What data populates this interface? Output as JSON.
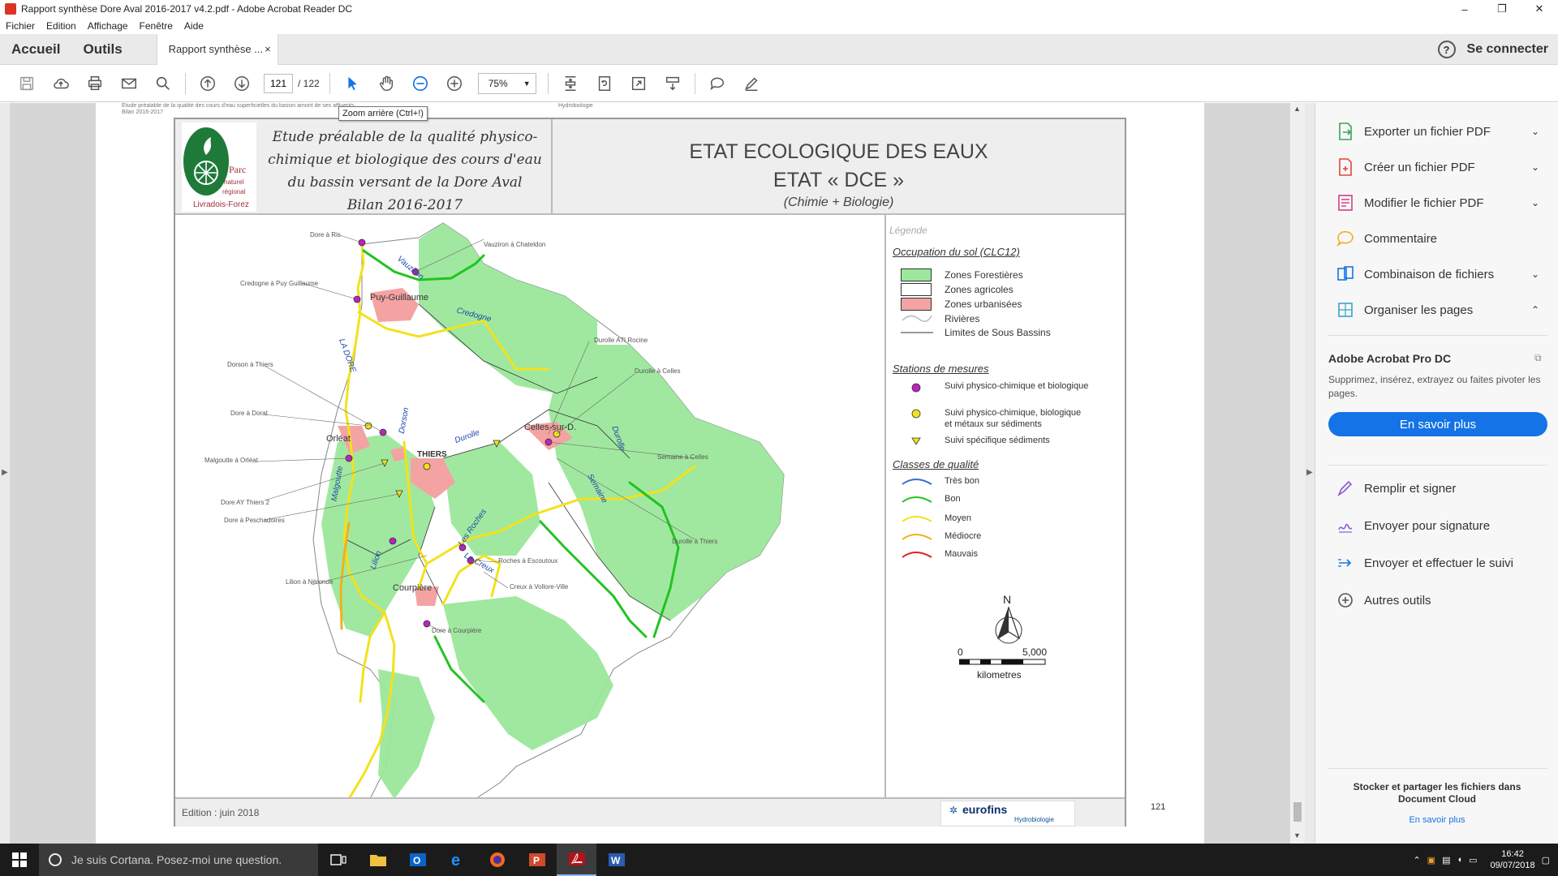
{
  "window": {
    "title": "Rapport synthèse Dore Aval 2016-2017 v4.2.pdf - Adobe Acrobat Reader DC",
    "controls": [
      "–",
      "❐",
      "✕"
    ]
  },
  "menu": [
    "Fichier",
    "Edition",
    "Affichage",
    "Fenêtre",
    "Aide"
  ],
  "tabs": {
    "home": "Accueil",
    "tools": "Outils",
    "document": "Rapport synthèse ...",
    "close": "×",
    "help": "?",
    "signin": "Se connecter"
  },
  "toolbar": {
    "page_current": "121",
    "page_total": "/ 122",
    "zoom": "75%",
    "tooltip": "Zoom arrière (Ctrl+!)"
  },
  "page": {
    "tiny_header_1": "Etude préalable de la qualité des cours d'eau superficielles du bassin amont de ses affluents",
    "tiny_header_2": "Bilan 2016-2017",
    "tiny_header_3": "Hydrobiologie",
    "study_title": "Etude préalable de la qualité physico-chimique et biologique des cours d'eau du bassin versant de la Dore Aval",
    "study_subtitle": "Bilan 2016-2017",
    "logo_text_1": "Parc",
    "logo_text_2": "naturel",
    "logo_text_3": "régional",
    "logo_text_4": "Livradois-Forez",
    "main_title_1": "ETAT ECOLOGIQUE DES EAUX",
    "main_title_2": "ETAT « DCE »",
    "main_title_3": "(Chimie + Biologie)",
    "edition": "Edition : juin 2018",
    "eurofins": "eurofins",
    "eurofins_sub": "Hydrobiologie",
    "page_number": "121"
  },
  "map": {
    "stations": [
      "Dore à Ris",
      "Vauziron à Chateldon",
      "Credogne à Puy Guillaume",
      "Durolle A7I Rocine",
      "Dorson à Thiers",
      "Durolle à Celles",
      "Dore à Dorat",
      "Malgoutte à Orléat",
      "Semaine à Celles",
      "Dore AY Thiers 2",
      "Dore à Peschadoires",
      "Durolle à Thiers",
      "Roches à Escoutoux",
      "Lilion à Néronde",
      "Creux à Vollore-Ville",
      "Dore à Courpière"
    ],
    "towns": [
      "Puy-Guillaume",
      "Orléat",
      "THIERS",
      "Celles-sur-D.",
      "Courpière"
    ],
    "rivers": [
      "Vauziron",
      "Credogne",
      "LA DORE",
      "Dorson",
      "Durolle",
      "Durolle",
      "Semaine",
      "Malgoutte",
      "Les Roches",
      "Le Creux",
      "Lilion"
    ]
  },
  "legend": {
    "title": "Légende",
    "land_title": "Occupation du sol (CLC12)",
    "land": [
      "Zones Forestières",
      "Zones agricoles",
      "Zones urbanisées",
      "Rivières",
      "Limites de Sous Bassins"
    ],
    "stations_title": "Stations de mesures",
    "station_types": [
      "Suivi physico-chimique et biologique",
      "Suivi physico-chimique, biologique",
      "et métaux sur sédiments",
      "Suivi spécifique sédiments"
    ],
    "quality_title": "Classes de qualité",
    "quality": [
      "Très bon",
      "Bon",
      "Moyen",
      "Médiocre",
      "Mauvais"
    ],
    "north": "N",
    "scale_0": "0",
    "scale_max": "5,000",
    "scale_unit": "kilometres"
  },
  "colors": {
    "forest": "#9be79b",
    "urban": "#f4a3a3",
    "tres_bon": "#3a6bd0",
    "bon": "#22c322",
    "moyen": "#f2e21c",
    "mediocre": "#f0b020",
    "mauvais": "#e02020",
    "station_pc": "#c020c0",
    "station_met": "#f2e21c",
    "accent": "#1473e6"
  },
  "right_panel": {
    "items": [
      "Exporter un fichier PDF",
      "Créer un fichier PDF",
      "Modifier le fichier PDF",
      "Commentaire",
      "Combinaison de fichiers",
      "Organiser les pages"
    ],
    "pro_title": "Adobe Acrobat Pro DC",
    "pro_desc": "Supprimez, insérez, extrayez ou faites pivoter les pages.",
    "pro_button": "En savoir plus",
    "items2": [
      "Remplir et signer",
      "Envoyer pour signature",
      "Envoyer et effectuer le suivi",
      "Autres outils"
    ],
    "store_title": "Stocker et partager les fichiers dans Document Cloud",
    "store_link": "En savoir plus"
  },
  "taskbar": {
    "search": "Je suis Cortana. Posez-moi une question.",
    "time": "16:42",
    "date": "09/07/2018"
  }
}
